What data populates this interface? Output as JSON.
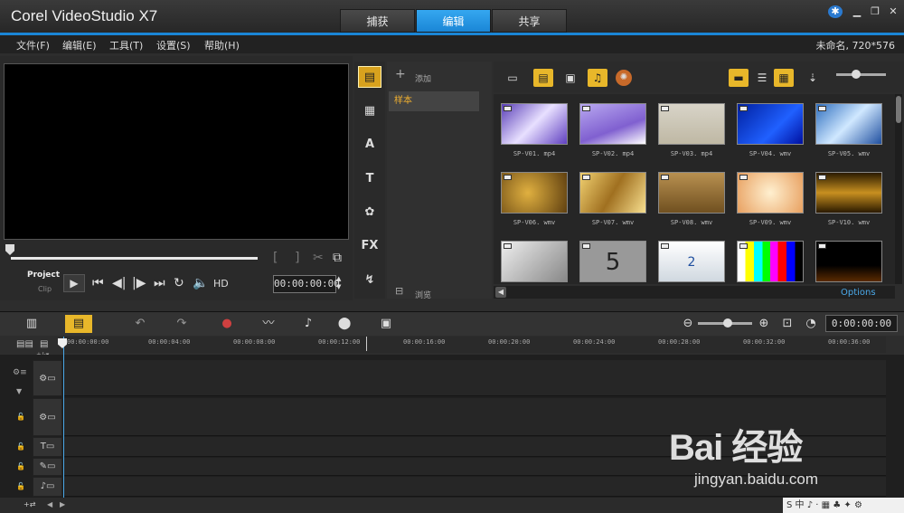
{
  "app": {
    "title": "Corel  VideoStudio X7",
    "project_info": "未命名, 720*576"
  },
  "tabs": [
    {
      "label": "捕获"
    },
    {
      "label": "编辑"
    },
    {
      "label": "共享"
    }
  ],
  "menu": [
    {
      "label": "文件(F)"
    },
    {
      "label": "编辑(E)"
    },
    {
      "label": "工具(T)"
    },
    {
      "label": "设置(S)"
    },
    {
      "label": "帮助(H)"
    }
  ],
  "player": {
    "mode_project": "Project",
    "mode_clip": "Clip",
    "hd": "HD",
    "timecode": "00:00:00:00"
  },
  "library": {
    "add_label": "添加",
    "folder_sample": "样本",
    "browse_label": "浏览",
    "options_label": "Options",
    "fx_label": "FX",
    "thumbs": [
      {
        "label": "SP-V01. mp4"
      },
      {
        "label": "SP-V02. mp4"
      },
      {
        "label": "SP-V03. mp4"
      },
      {
        "label": "SP-V04. wmv"
      },
      {
        "label": "SP-V05. wmv"
      },
      {
        "label": "SP-V06. wmv"
      },
      {
        "label": "SP-V07. wmv"
      },
      {
        "label": "SP-V08. wmv"
      },
      {
        "label": "SP-V09. wmv"
      },
      {
        "label": "SP-V10. wmv"
      },
      {
        "label": ""
      },
      {
        "label": ""
      },
      {
        "label": ""
      },
      {
        "label": ""
      },
      {
        "label": ""
      }
    ]
  },
  "timeline": {
    "timecode": "0:00:00:00",
    "ruler": [
      "00:00:00:00",
      "00:00:04:00",
      "00:00:08:00",
      "00:00:12:00",
      "00:00:16:00",
      "00:00:20:00",
      "00:00:24:00",
      "00:00:28:00",
      "00:00:32:00",
      "00:00:36:00"
    ]
  },
  "watermark": {
    "logo": "Bai  经验",
    "url": "jingyan.baidu.com"
  },
  "tray": {
    "text": "S 中 ♪ · ▦ ♣ ✦ ⚙"
  },
  "colors": {
    "accent": "#1a86d6",
    "highlight": "#e8b72a",
    "folder_text": "#f0b030"
  }
}
